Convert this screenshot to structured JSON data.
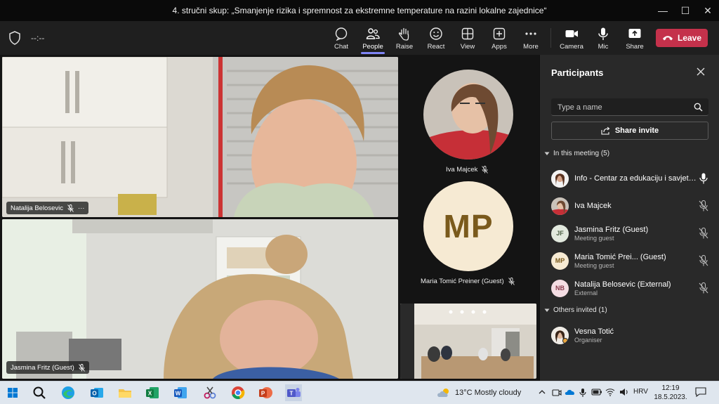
{
  "window": {
    "title": "4. stručni skup: „Smanjenje rizika i spremnost za ekstremne temperature na razini lokalne zajednice“",
    "minimize": "—",
    "maximize": "☐",
    "close": "✕"
  },
  "toolbar": {
    "timer": "--:--",
    "buttons": {
      "chat": "Chat",
      "people": "People",
      "raise": "Raise",
      "react": "React",
      "view": "View",
      "apps": "Apps",
      "more": "More",
      "camera": "Camera",
      "mic": "Mic",
      "share": "Share"
    },
    "leave": "Leave"
  },
  "stage": {
    "tiles": [
      {
        "name": "Natalija Belosevic",
        "more": "···"
      },
      {
        "name": "Jasmina Fritz (Guest)"
      }
    ],
    "avatars": [
      {
        "name": "Iva Majcek"
      },
      {
        "name": "Maria Tomić Preiner (Guest)",
        "initials": "MP"
      }
    ]
  },
  "panel": {
    "title": "Participants",
    "search_placeholder": "Type a name",
    "share_invite": "Share invite",
    "in_meeting_label": "In this meeting (5)",
    "participants": [
      {
        "name": "Info - Centar za edukaciju i savjetovanje",
        "sub": "",
        "initials": "",
        "mic": "on"
      },
      {
        "name": "Iva Majcek",
        "sub": "",
        "initials": "",
        "mic": "muted"
      },
      {
        "name": "Jasmina Fritz (Guest)",
        "sub": "Meeting guest",
        "initials": "JF",
        "mic": "muted"
      },
      {
        "name": "Maria Tomić Prei... (Guest)",
        "sub": "Meeting guest",
        "initials": "MP",
        "mic": "muted"
      },
      {
        "name": "Natalija Belosevic (External)",
        "sub": "External",
        "initials": "NB",
        "mic": "muted"
      }
    ],
    "others_label": "Others invited (1)",
    "others": [
      {
        "name": "Vesna Totić",
        "sub": "Organiser"
      }
    ]
  },
  "taskbar": {
    "weather": "13°C  Mostly cloudy",
    "lang": "HRV",
    "time": "12:19",
    "date": "18.5.2023."
  },
  "colors": {
    "accent": "#7f85f5",
    "leave": "#c4314b",
    "panel_bg": "#292929",
    "toolbar_bg": "#1f1f1f"
  }
}
